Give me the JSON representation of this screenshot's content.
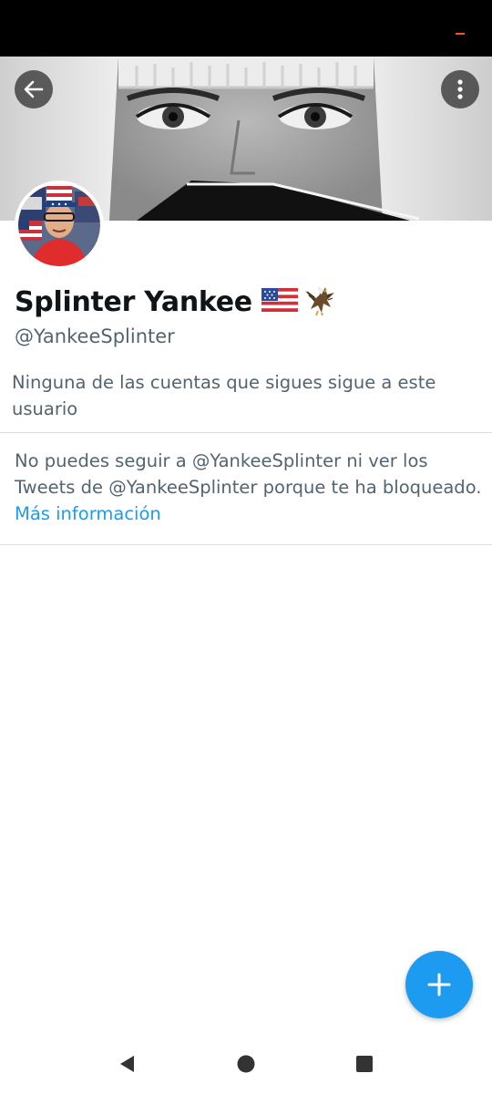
{
  "profile": {
    "display_name": "Splinter Yankee",
    "name_emojis": [
      "us-flag-icon",
      "eagle-icon"
    ],
    "handle": "@YankeeSplinter"
  },
  "followers_note": "Ninguna de las cuentas que sigues sigue a este usuario",
  "blocked_notice": {
    "line1": "No puedes seguir a @YankeeSplinter ni ver los",
    "line2": "Tweets de @YankeeSplinter porque te ha bloqueado.",
    "learn_more": "Más información"
  },
  "icons": {
    "header_left": "back-arrow-icon",
    "header_right": "more-vertical-icon",
    "fab": "plus-icon",
    "nav": [
      "nav-back-icon",
      "nav-home-icon",
      "nav-recents-icon"
    ]
  },
  "colors": {
    "accent": "#1d9bf0",
    "text_primary": "#0f1419",
    "text_secondary": "#536471",
    "status_bar": "#000000"
  }
}
